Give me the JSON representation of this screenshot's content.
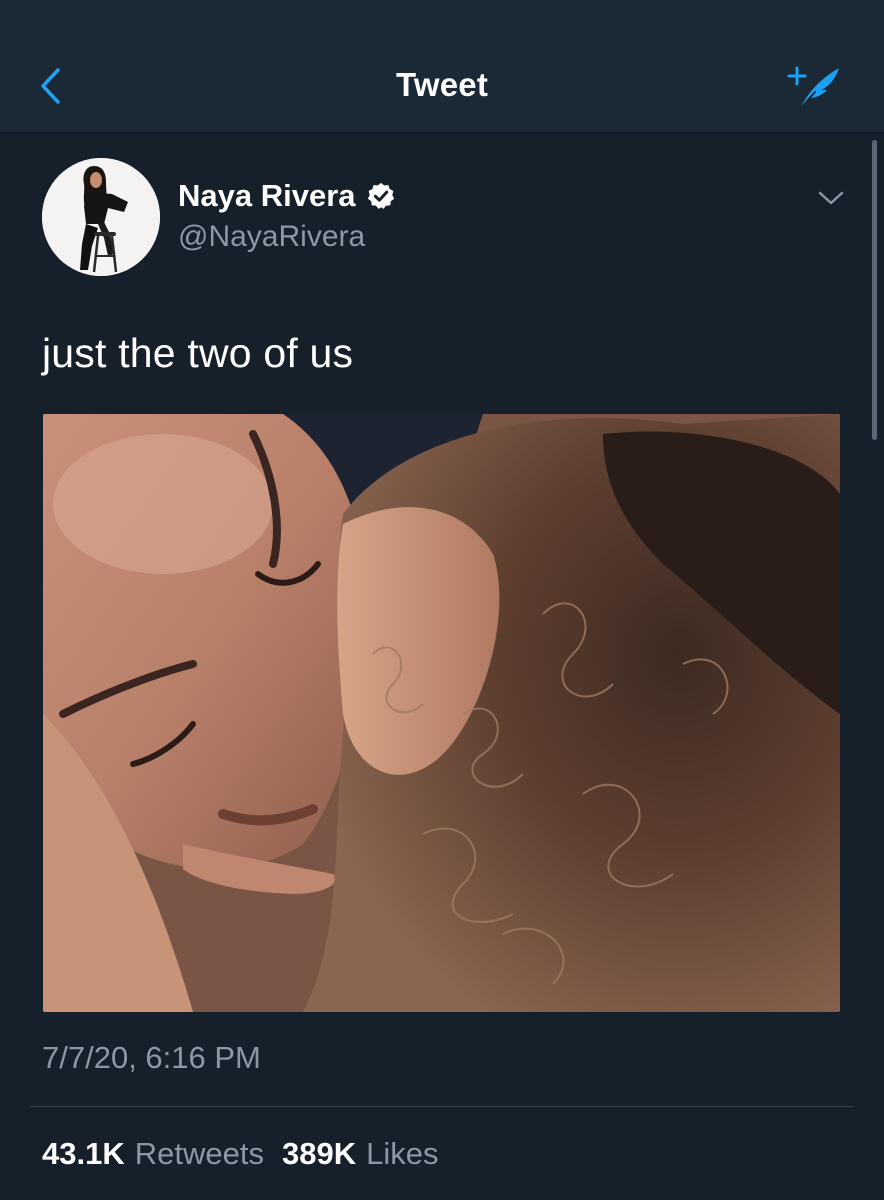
{
  "header": {
    "title": "Tweet",
    "back_icon": "chevron-left-icon",
    "compose_icon": "compose-feather-icon",
    "accent_color": "#1da1f2"
  },
  "tweet": {
    "display_name": "Naya Rivera",
    "verified_icon": "verified-badge-icon",
    "handle": "@NayaRivera",
    "menu_icon": "chevron-down-icon",
    "text": "just the two of us",
    "timestamp": "7/7/20, 6:16 PM"
  },
  "stats": {
    "retweets_count": "43.1K",
    "retweets_label": "Retweets",
    "likes_count": "389K",
    "likes_label": "Likes"
  },
  "colors": {
    "background": "#15202b",
    "header_background": "#1b2836",
    "secondary_text": "#8b98a5"
  }
}
